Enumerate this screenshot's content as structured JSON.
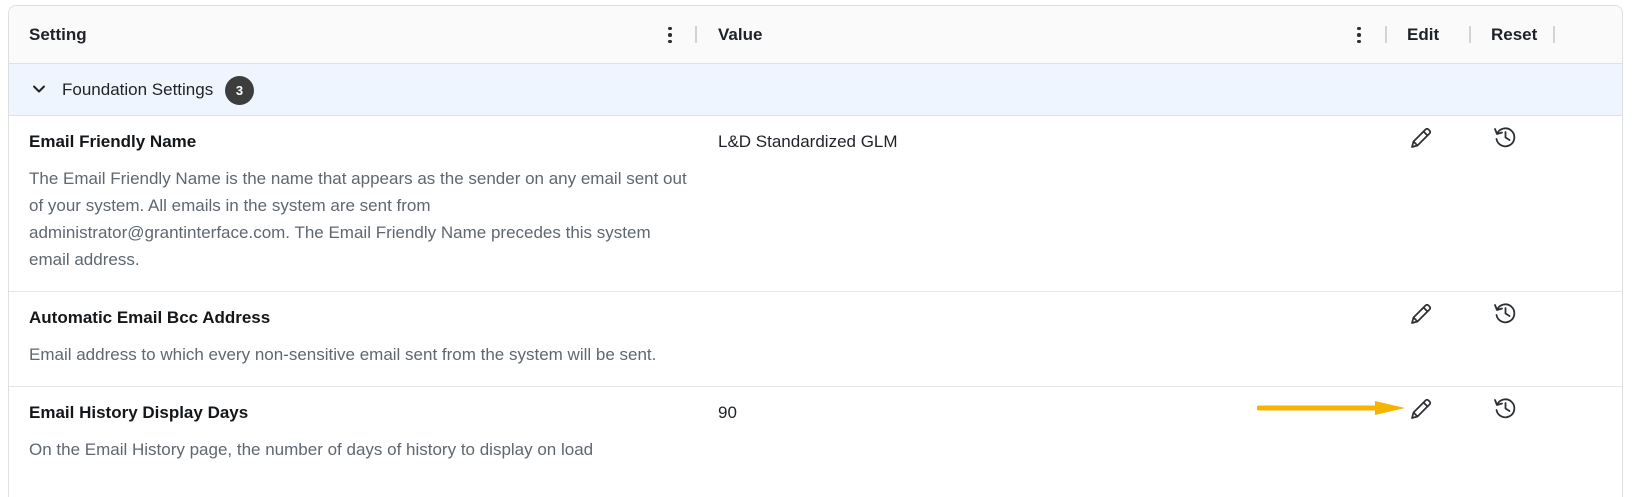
{
  "header": {
    "col_setting": "Setting",
    "col_value": "Value",
    "col_edit": "Edit",
    "col_reset": "Reset"
  },
  "group": {
    "label": "Foundation Settings",
    "count": "3",
    "expanded": true
  },
  "rows": [
    {
      "title": "Email Friendly Name",
      "description": "The Email Friendly Name is the name that appears as the sender on any email sent out of your system. All emails in the system are sent from administrator@grantinterface.com. The Email Friendly Name precedes this system email address.",
      "value": "L&D Standardized GLM"
    },
    {
      "title": "Automatic Email Bcc Address",
      "description": "Email address to which every non-sensitive email sent from the system will be sent.",
      "value": ""
    },
    {
      "title": "Email History Display Days",
      "description": "On the Email History page, the number of days of history to display on load",
      "value": "90"
    }
  ],
  "icons": {
    "edit": "pencil-icon",
    "reset": "history-icon",
    "expand": "chevron-down-icon",
    "column_menu": "kebab-menu-icon"
  },
  "colors": {
    "group_bg": "#eef5fe",
    "badge_bg": "#3d3d3d",
    "annotation_arrow": "#f5b400"
  }
}
